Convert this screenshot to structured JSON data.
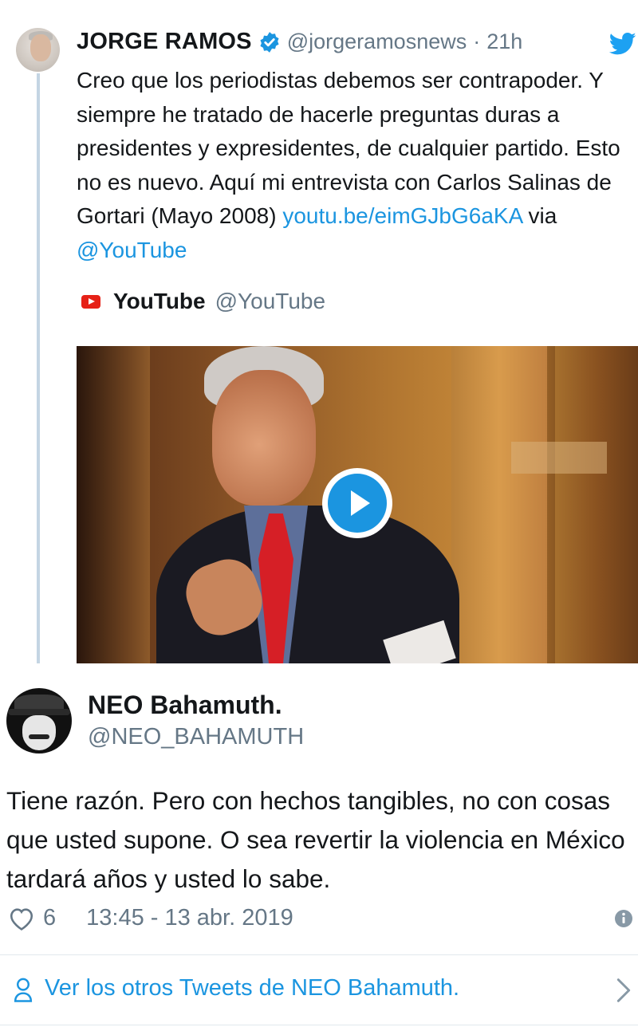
{
  "original_tweet": {
    "author_name": "JORGE RAMOS",
    "handle": "@jorgeramosnews",
    "separator": "·",
    "time": "21h",
    "text": "Creo que los periodistas debemos ser contrapoder. Y siempre he tratado de hacerle preguntas duras a presidentes y expresidentes, de cualquier partido. Esto no es nuevo. Aquí mi entrevista con Carlos Salinas de Gortari (Mayo 2008) ",
    "link": "youtu.be/eimGJbG6aKA",
    "via": " via ",
    "mention": "@YouTube",
    "card": {
      "source_name": "YouTube",
      "source_handle": "@YouTube"
    }
  },
  "reply": {
    "author_name": "NEO Bahamuth.",
    "handle": "@NEO_BAHAMUTH",
    "text": "Tiene razón.  Pero con hechos tangibles, no con cosas que usted supone. O sea revertir la violencia en México tardará años y usted lo sabe.",
    "likes": "6",
    "timestamp": "13:45 - 13 abr. 2019"
  },
  "footer": {
    "more_tweets_label": "Ver los otros Tweets de NEO Bahamuth."
  },
  "colors": {
    "link": "#1b95e0",
    "secondary_text": "#657786",
    "thread_line": "#c4d5e3",
    "youtube_red": "#e62117"
  }
}
